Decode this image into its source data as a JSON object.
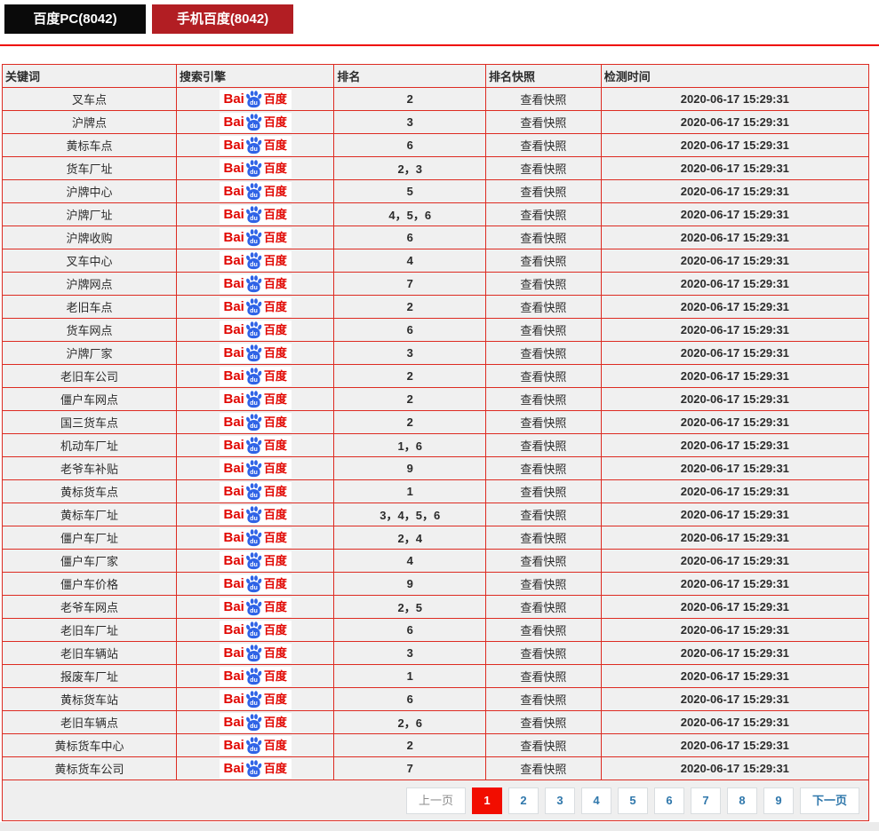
{
  "tabs": [
    {
      "id": "pc",
      "label": "百度PC(8042)"
    },
    {
      "id": "mobile",
      "label": "手机百度(8042)"
    }
  ],
  "table": {
    "headers": [
      "关键词",
      "搜索引擎",
      "排名",
      "排名快照",
      "检测时间"
    ],
    "engine_logo": {
      "bai": "Bai",
      "du": "du",
      "cn": "百度"
    },
    "snapshot_label": "查看快照",
    "rows": [
      {
        "keyword": "叉车点",
        "rank": "2",
        "time": "2020-06-17 15:29:31"
      },
      {
        "keyword": "沪牌点",
        "rank": "3",
        "time": "2020-06-17 15:29:31"
      },
      {
        "keyword": "黄标车点",
        "rank": "6",
        "time": "2020-06-17 15:29:31"
      },
      {
        "keyword": "货车厂址",
        "rank": "2，3",
        "time": "2020-06-17 15:29:31"
      },
      {
        "keyword": "沪牌中心",
        "rank": "5",
        "time": "2020-06-17 15:29:31"
      },
      {
        "keyword": "沪牌厂址",
        "rank": "4，5，6",
        "time": "2020-06-17 15:29:31"
      },
      {
        "keyword": "沪牌收购",
        "rank": "6",
        "time": "2020-06-17 15:29:31"
      },
      {
        "keyword": "叉车中心",
        "rank": "4",
        "time": "2020-06-17 15:29:31"
      },
      {
        "keyword": "沪牌网点",
        "rank": "7",
        "time": "2020-06-17 15:29:31"
      },
      {
        "keyword": "老旧车点",
        "rank": "2",
        "time": "2020-06-17 15:29:31"
      },
      {
        "keyword": "货车网点",
        "rank": "6",
        "time": "2020-06-17 15:29:31"
      },
      {
        "keyword": "沪牌厂家",
        "rank": "3",
        "time": "2020-06-17 15:29:31"
      },
      {
        "keyword": "老旧车公司",
        "rank": "2",
        "time": "2020-06-17 15:29:31"
      },
      {
        "keyword": "僵户车网点",
        "rank": "2",
        "time": "2020-06-17 15:29:31"
      },
      {
        "keyword": "国三货车点",
        "rank": "2",
        "time": "2020-06-17 15:29:31"
      },
      {
        "keyword": "机动车厂址",
        "rank": "1，6",
        "time": "2020-06-17 15:29:31"
      },
      {
        "keyword": "老爷车补贴",
        "rank": "9",
        "time": "2020-06-17 15:29:31"
      },
      {
        "keyword": "黄标货车点",
        "rank": "1",
        "time": "2020-06-17 15:29:31"
      },
      {
        "keyword": "黄标车厂址",
        "rank": "3，4，5，6",
        "time": "2020-06-17 15:29:31"
      },
      {
        "keyword": "僵户车厂址",
        "rank": "2，4",
        "time": "2020-06-17 15:29:31"
      },
      {
        "keyword": "僵户车厂家",
        "rank": "4",
        "time": "2020-06-17 15:29:31"
      },
      {
        "keyword": "僵户车价格",
        "rank": "9",
        "time": "2020-06-17 15:29:31"
      },
      {
        "keyword": "老爷车网点",
        "rank": "2，5",
        "time": "2020-06-17 15:29:31"
      },
      {
        "keyword": "老旧车厂址",
        "rank": "6",
        "time": "2020-06-17 15:29:31"
      },
      {
        "keyword": "老旧车辆站",
        "rank": "3",
        "time": "2020-06-17 15:29:31"
      },
      {
        "keyword": "报废车厂址",
        "rank": "1",
        "time": "2020-06-17 15:29:31"
      },
      {
        "keyword": "黄标货车站",
        "rank": "6",
        "time": "2020-06-17 15:29:31"
      },
      {
        "keyword": "老旧车辆点",
        "rank": "2，6",
        "time": "2020-06-17 15:29:31"
      },
      {
        "keyword": "黄标货车中心",
        "rank": "2",
        "time": "2020-06-17 15:29:31"
      },
      {
        "keyword": "黄标货车公司",
        "rank": "7",
        "time": "2020-06-17 15:29:31"
      }
    ]
  },
  "pagination": {
    "prev": "上一页",
    "next": "下一页",
    "pages": [
      "1",
      "2",
      "3",
      "4",
      "5",
      "6",
      "7",
      "8",
      "9"
    ],
    "active": "1"
  },
  "colors": {
    "tab_pc_bg": "#0a0a0a",
    "tab_mobile_bg": "#b21e23",
    "table_border": "#dd2b22",
    "cell_bg": "#f0f0f0",
    "active_page_bg": "#f20d00",
    "page_link": "#2f77ab",
    "logo_red": "#e10601",
    "logo_blue": "#2f63e6"
  }
}
